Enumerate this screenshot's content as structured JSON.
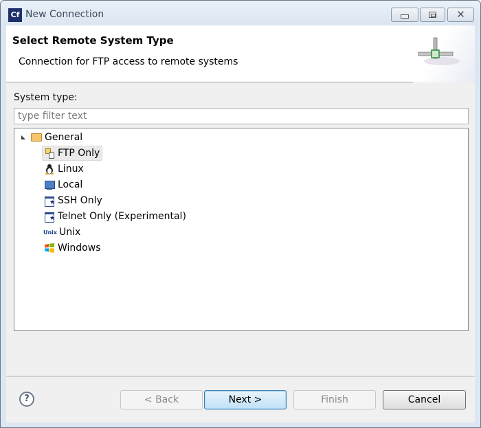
{
  "window": {
    "title": "New Connection",
    "app_icon_text": "Cf",
    "controls": {
      "minimize": "minimize",
      "maximize": "maximize",
      "close": "✕"
    }
  },
  "banner": {
    "title": "Select Remote System Type",
    "description": "Connection for FTP access to remote systems",
    "graphic": "network-connection-icon"
  },
  "system_type": {
    "label": "System type:",
    "filter_placeholder": "type filter text",
    "filter_value": ""
  },
  "tree": {
    "root": {
      "label": "General",
      "icon": "folder-open-icon",
      "expanded": true
    },
    "items": [
      {
        "label": "FTP Only",
        "icon": "ftp-icon",
        "selected": true
      },
      {
        "label": "Linux",
        "icon": "linux-icon",
        "selected": false
      },
      {
        "label": "Local",
        "icon": "local-computer-icon",
        "selected": false
      },
      {
        "label": "SSH Only",
        "icon": "ssh-terminal-icon",
        "selected": false
      },
      {
        "label": "Telnet Only (Experimental)",
        "icon": "telnet-terminal-icon",
        "selected": false
      },
      {
        "label": "Unix",
        "icon": "unix-icon",
        "icon_text": "Unix",
        "selected": false
      },
      {
        "label": "Windows",
        "icon": "windows-icon",
        "selected": false
      }
    ]
  },
  "buttons": {
    "help": "?",
    "back": "< Back",
    "next": "Next >",
    "finish": "Finish",
    "cancel": "Cancel"
  },
  "state": {
    "back_enabled": false,
    "next_enabled": true,
    "finish_enabled": false,
    "cancel_enabled": true
  }
}
